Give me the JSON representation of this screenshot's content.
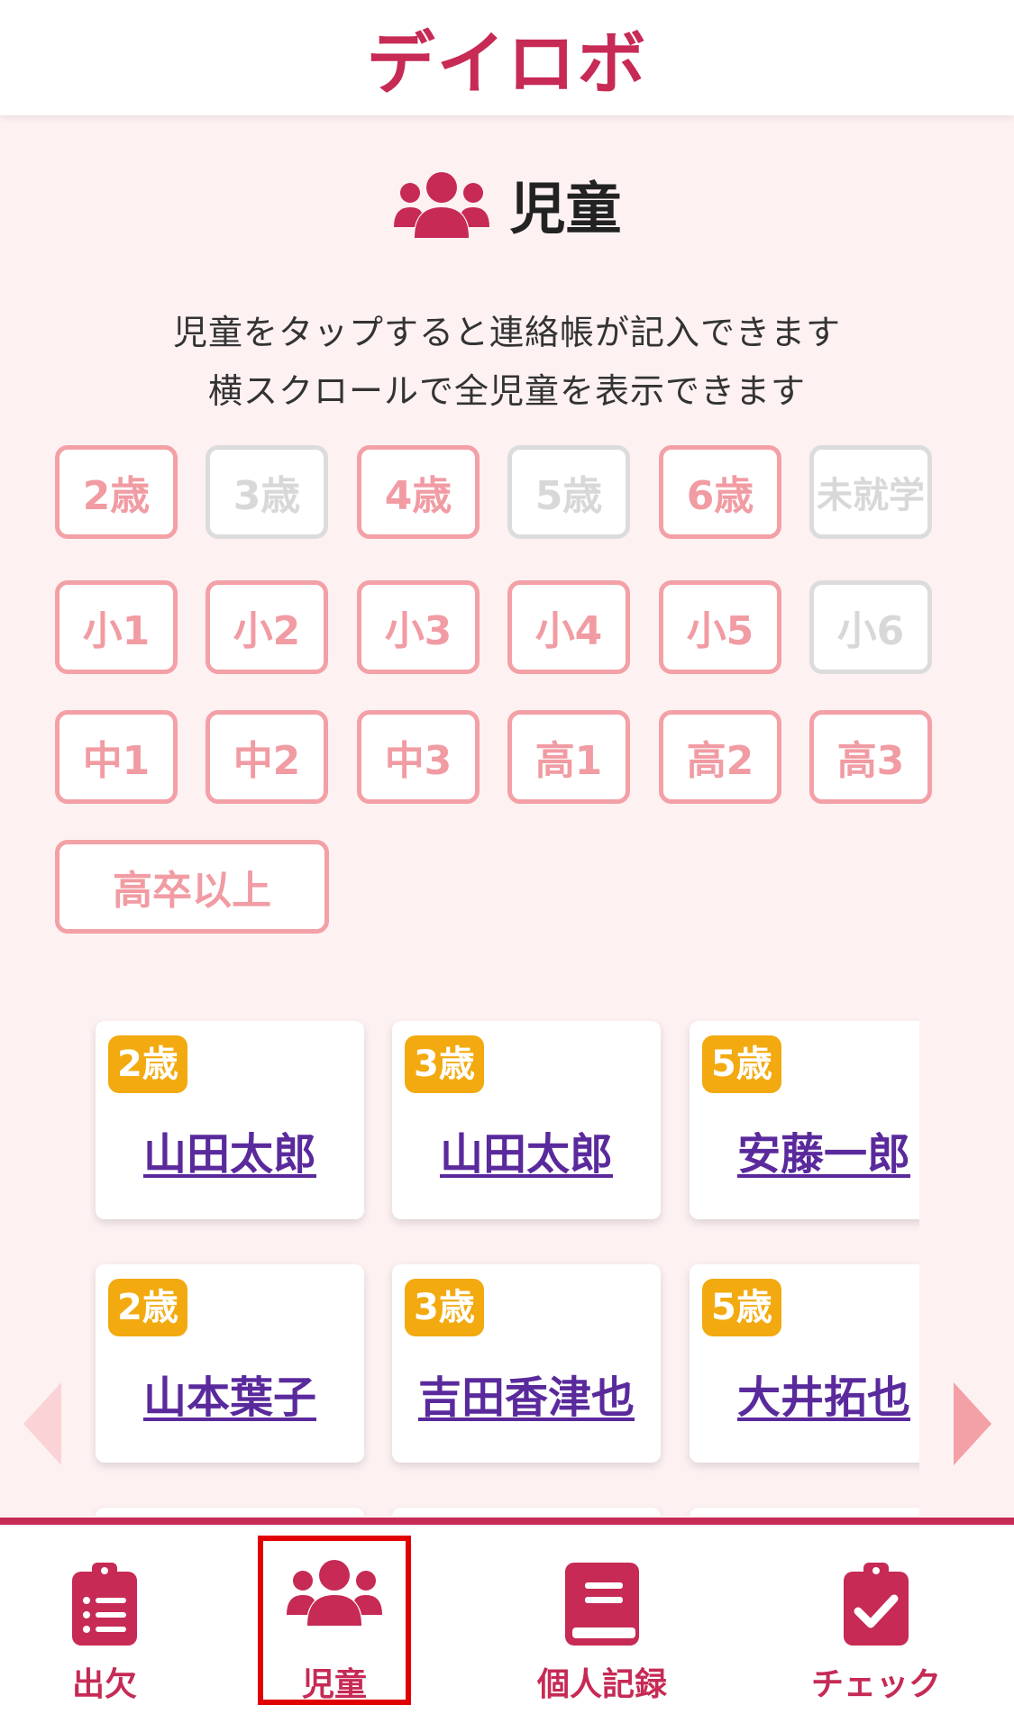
{
  "app": {
    "brand": "デイロボ"
  },
  "page": {
    "title": "児童",
    "instructions": [
      "児童をタップすると連絡帳が記入できます",
      "横スクロールで全児童を表示できます"
    ]
  },
  "filters": [
    {
      "label": "2歳",
      "enabled": true
    },
    {
      "label": "3歳",
      "enabled": false
    },
    {
      "label": "4歳",
      "enabled": true
    },
    {
      "label": "5歳",
      "enabled": false
    },
    {
      "label": "6歳",
      "enabled": true
    },
    {
      "label": "未就学",
      "enabled": false
    },
    {
      "label": "小1",
      "enabled": true
    },
    {
      "label": "小2",
      "enabled": true
    },
    {
      "label": "小3",
      "enabled": true
    },
    {
      "label": "小4",
      "enabled": true
    },
    {
      "label": "小5",
      "enabled": true
    },
    {
      "label": "小6",
      "enabled": false
    },
    {
      "label": "中1",
      "enabled": true
    },
    {
      "label": "中2",
      "enabled": true
    },
    {
      "label": "中3",
      "enabled": true
    },
    {
      "label": "高1",
      "enabled": true
    },
    {
      "label": "高2",
      "enabled": true
    },
    {
      "label": "高3",
      "enabled": true
    },
    {
      "label": "高卒以上",
      "enabled": true
    }
  ],
  "children": [
    {
      "grade": "2歳",
      "name": "山田太郎"
    },
    {
      "grade": "3歳",
      "name": "山田太郎"
    },
    {
      "grade": "5歳",
      "name": "安藤一郎"
    },
    {
      "grade": "2歳",
      "name": "山本葉子"
    },
    {
      "grade": "3歳",
      "name": "吉田香津也"
    },
    {
      "grade": "5歳",
      "name": "大井拓也"
    }
  ],
  "nav": [
    {
      "label": "出欠",
      "icon": "clipboard-list-icon"
    },
    {
      "label": "児童",
      "icon": "users-icon",
      "active": true
    },
    {
      "label": "個人記録",
      "icon": "book-icon"
    },
    {
      "label": "チェック",
      "icon": "clipboard-check-icon"
    }
  ],
  "colors": {
    "brand": "#c62a55",
    "filter_enabled": "#f3a0a6",
    "filter_disabled": "#dcdcdc",
    "badge": "#f2aa10",
    "link": "#5a2a9c",
    "active_outline": "#e00000"
  }
}
